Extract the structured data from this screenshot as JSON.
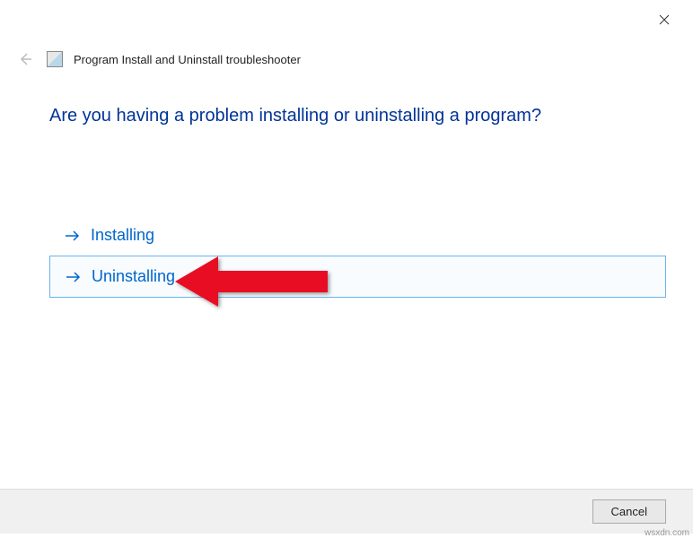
{
  "window": {
    "title": "Program Install and Uninstall troubleshooter"
  },
  "main": {
    "question": "Are you having a problem installing or uninstalling a program?"
  },
  "options": {
    "installing": "Installing",
    "uninstalling": "Uninstalling"
  },
  "footer": {
    "cancel": "Cancel"
  },
  "watermark": "wsxdn.com"
}
